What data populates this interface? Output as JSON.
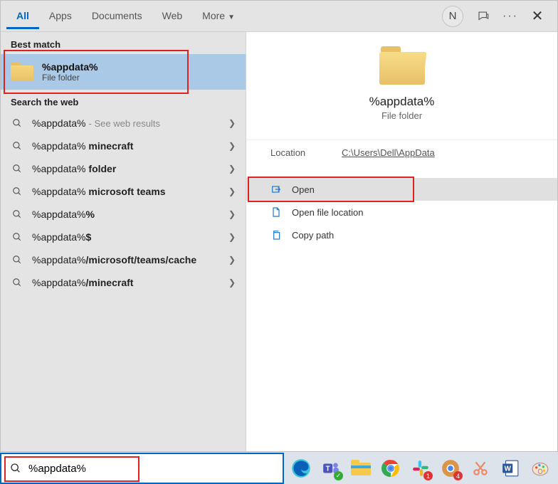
{
  "tabs": {
    "all": "All",
    "apps": "Apps",
    "documents": "Documents",
    "web": "Web",
    "more": "More"
  },
  "avatar_initial": "N",
  "sections": {
    "best_match": "Best match",
    "search_web": "Search the web"
  },
  "best_match": {
    "title": "%appdata%",
    "subtitle": "File folder"
  },
  "suggestions": [
    {
      "text": "%appdata%",
      "hint": "- See web results"
    },
    {
      "prefix": "%appdata% ",
      "bold": "minecraft"
    },
    {
      "prefix": "%appdata% ",
      "bold": "folder"
    },
    {
      "prefix": "%appdata% ",
      "bold": "microsoft teams"
    },
    {
      "prefix": "%appdata%",
      "bold": "%"
    },
    {
      "prefix": "%appdata%",
      "bold": "$"
    },
    {
      "prefix": "%appdata%",
      "bold": "/microsoft/teams/cache"
    },
    {
      "prefix": "%appdata%",
      "bold": "/minecraft"
    }
  ],
  "preview": {
    "title": "%appdata%",
    "subtitle": "File folder",
    "location_label": "Location",
    "location_value": "C:\\Users\\Dell\\AppData",
    "actions": {
      "open": "Open",
      "open_loc": "Open file location",
      "copy": "Copy path"
    }
  },
  "search_value": "%appdata%"
}
